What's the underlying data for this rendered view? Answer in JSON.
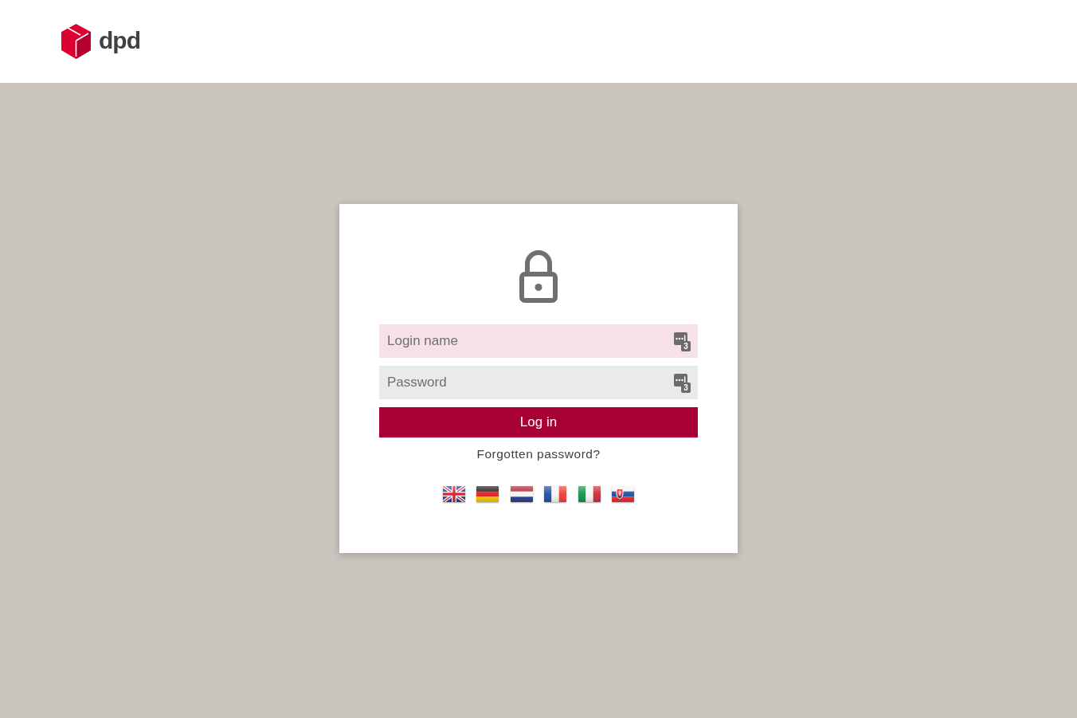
{
  "header": {
    "logo_text": "dpd"
  },
  "login_form": {
    "fields": [
      {
        "placeholder": "Login name",
        "highlighted": true,
        "badge": "3"
      },
      {
        "placeholder": "Password",
        "highlighted": false,
        "badge": "3"
      }
    ],
    "submit_button": "Log in",
    "forgot_password_link": "Forgotten password?",
    "language_flags": [
      {
        "kind": "gb"
      },
      {
        "kind": "de"
      },
      {
        "kind": "nl"
      },
      {
        "kind": "fr"
      },
      {
        "kind": "it"
      },
      {
        "kind": "sk"
      }
    ]
  }
}
